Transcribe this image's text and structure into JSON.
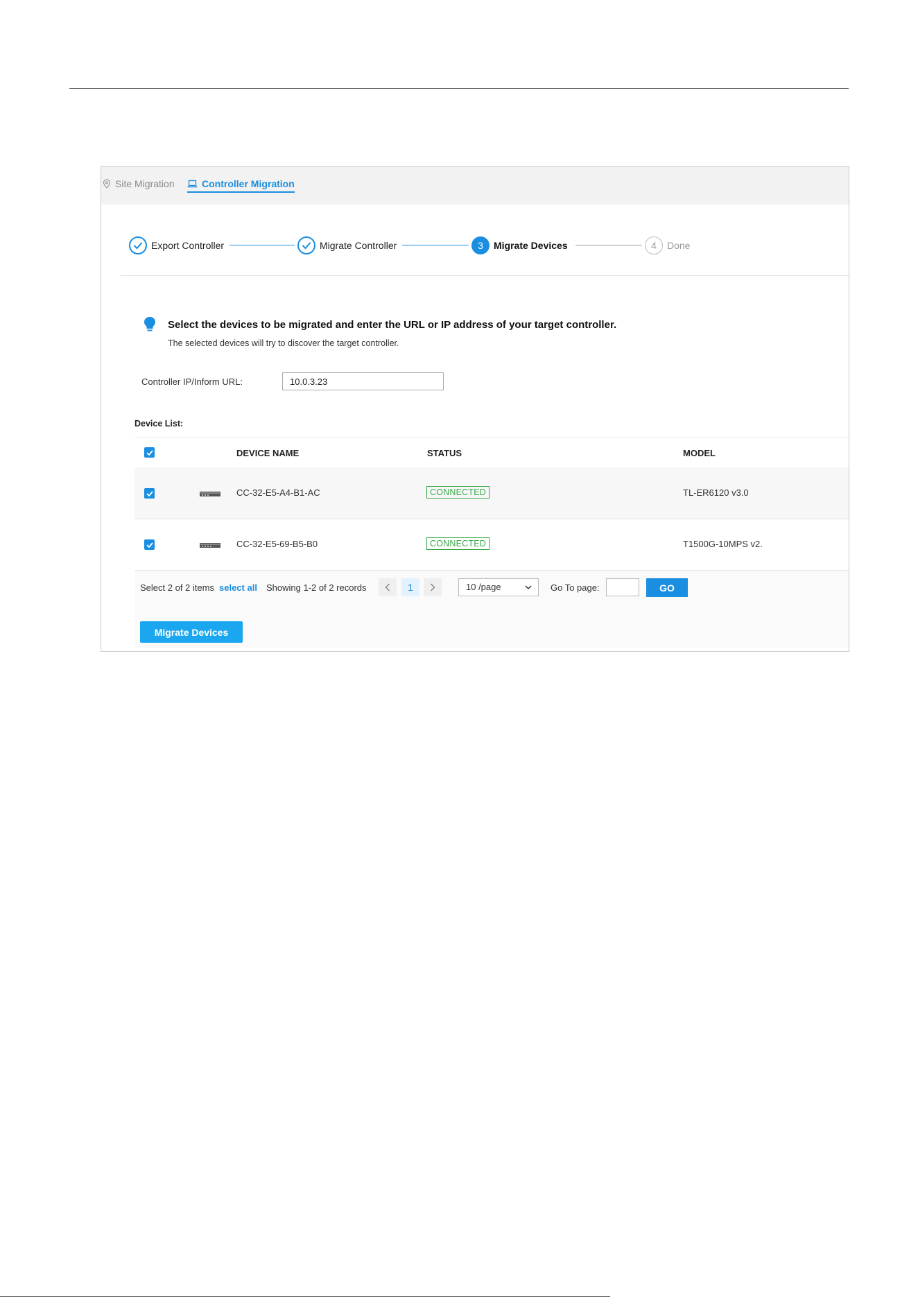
{
  "tabs": [
    {
      "label": "Site Migration",
      "icon": "location-pin-icon",
      "active": false
    },
    {
      "label": "Controller Migration",
      "icon": "laptop-icon",
      "active": true
    }
  ],
  "steps": [
    {
      "label": "Export Controller",
      "state": "done",
      "number": "1"
    },
    {
      "label": "Migrate Controller",
      "state": "done",
      "number": "2"
    },
    {
      "label": "Migrate Devices",
      "state": "active",
      "number": "3"
    },
    {
      "label": "Done",
      "state": "todo",
      "number": "4"
    }
  ],
  "notice": {
    "title": "Select the devices to be migrated and enter the URL or IP address of your target controller.",
    "subtitle": "The selected devices will try to discover the target controller.",
    "icon": "lightbulb-icon"
  },
  "controller": {
    "label": "Controller IP/Inform URL:",
    "value": "10.0.3.23"
  },
  "device_list": {
    "label": "Device List:",
    "columns": [
      "DEVICE NAME",
      "STATUS",
      "MODEL"
    ],
    "rows": [
      {
        "checked": true,
        "name": "CC-32-E5-A4-B1-AC",
        "status": "CONNECTED",
        "model": "TL-ER6120 v3.0"
      },
      {
        "checked": true,
        "name": "CC-32-E5-69-B5-B0",
        "status": "CONNECTED",
        "model": "T1500G-10MPS v2."
      }
    ]
  },
  "footer": {
    "selection": "Select 2 of 2 items",
    "select_all": "select all",
    "showing": "Showing 1-2 of 2 records",
    "current_page": "1",
    "page_size": "10 /page",
    "goto_label": "Go To page:",
    "go": "GO"
  },
  "actions": {
    "migrate": "Migrate Devices"
  },
  "colors": {
    "accent": "#1a8ee0",
    "connected": "#39a84b",
    "button": "#1aa7ef"
  }
}
